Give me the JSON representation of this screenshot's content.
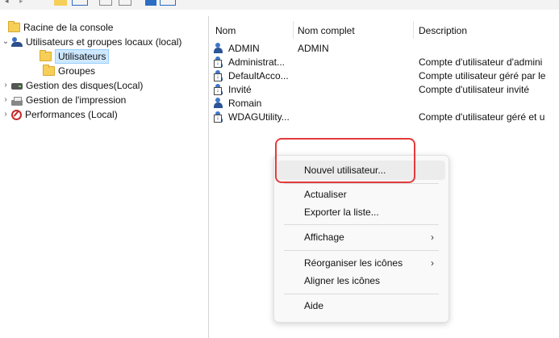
{
  "tree": {
    "root": "Racine de la console",
    "local_users": "Utilisateurs et groupes locaux (local)",
    "users": "Utilisateurs",
    "groups": "Groupes",
    "disks": "Gestion des disques(Local)",
    "printing": "Gestion de l'impression",
    "performance": "Performances (Local)"
  },
  "columns": {
    "name": "Nom",
    "full_name": "Nom complet",
    "description": "Description"
  },
  "rows": [
    {
      "name": "ADMIN",
      "full_name": "ADMIN",
      "description": ""
    },
    {
      "name": "Administrat...",
      "full_name": "",
      "description": "Compte d'utilisateur d'admini"
    },
    {
      "name": "DefaultAcco...",
      "full_name": "",
      "description": "Compte utilisateur géré par le"
    },
    {
      "name": "Invité",
      "full_name": "",
      "description": "Compte d'utilisateur invité"
    },
    {
      "name": "Romain",
      "full_name": "",
      "description": ""
    },
    {
      "name": "WDAGUtility...",
      "full_name": "",
      "description": "Compte d'utilisateur géré et u"
    }
  ],
  "context_menu": {
    "new_user": "Nouvel utilisateur...",
    "refresh": "Actualiser",
    "export": "Exporter la liste...",
    "view": "Affichage",
    "arrange": "Réorganiser les icônes",
    "align": "Aligner les icônes",
    "help": "Aide"
  },
  "colors": {
    "highlight": "#e23c3c",
    "selection": "#cde8ff"
  }
}
